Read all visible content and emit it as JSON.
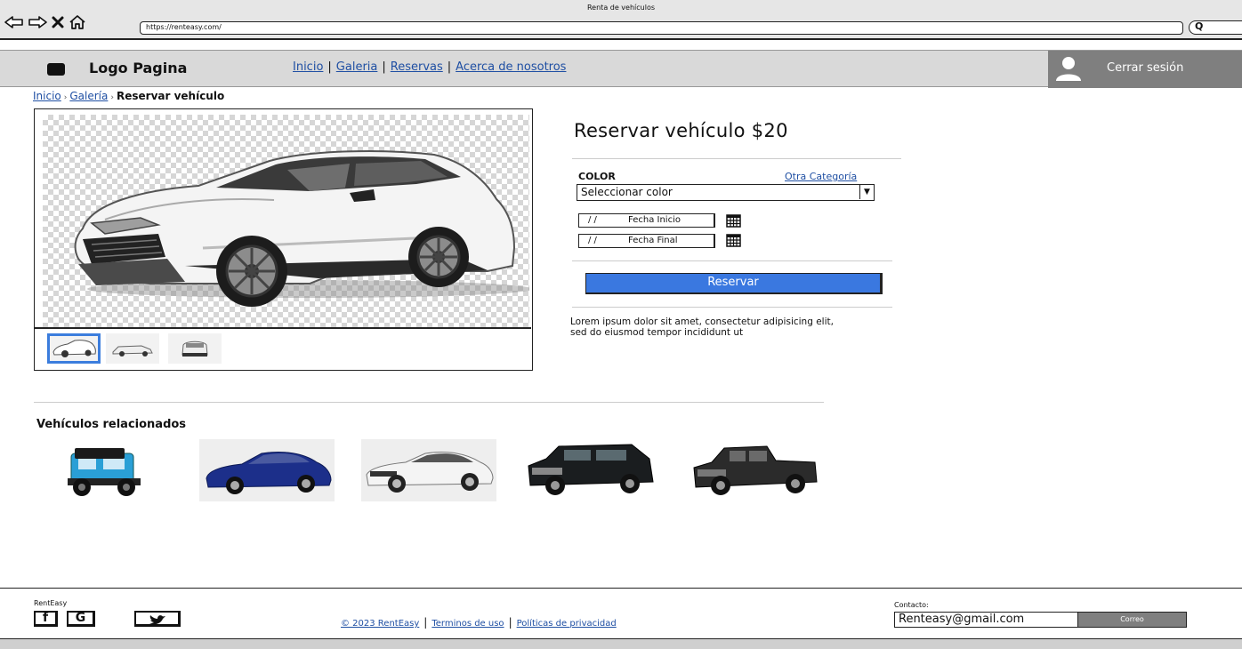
{
  "browser": {
    "window_title": "Renta de vehículos",
    "url": "https://renteasy.com/",
    "search_glyph": "Q"
  },
  "header": {
    "logo_text": "Logo Pagina",
    "nav": [
      "Inicio",
      "Galeria",
      "Reservas",
      "Acerca de nosotros"
    ],
    "logout_label": "Cerrar sesión"
  },
  "breadcrumb": {
    "items": [
      "Inicio",
      "Galería"
    ],
    "current": "Reservar vehículo"
  },
  "gallery": {
    "selected_thumbnail": 1,
    "thumbnail_count": 3
  },
  "booking": {
    "title": "Reservar vehículo $20",
    "color_label": "COLOR",
    "other_category_link": "Otra Categoría",
    "color_select_value": "Seleccionar color",
    "date_start_slashes": "/ /",
    "date_start_label": "Fecha Inicio",
    "date_end_slashes": "/ /",
    "date_end_label": "Fecha Final",
    "reserve_button": "Reservar",
    "description": "Lorem ipsum dolor sit amet, consectetur adipisicing elit, sed do eiusmod tempor incididunt ut"
  },
  "related": {
    "title": "Vehículos relacionados",
    "vehicles": [
      {
        "color": "#2a9fd6"
      },
      {
        "color": "#1c2f8a"
      },
      {
        "color": "#e8e8e8"
      },
      {
        "color": "#1a1d1f"
      },
      {
        "color": "#2b2b2b"
      }
    ]
  },
  "footer": {
    "brand": "RentEasy",
    "social": [
      "f",
      "G",
      "twitter"
    ],
    "copyright": "© 2023 RentEasy",
    "terms": "Terminos de uso",
    "privacy": "Políticas de privacidad",
    "contact_label": "Contacto:",
    "email_value": "Renteasy@gmail.com",
    "email_button": "Correo"
  },
  "colors": {
    "accent": "#3a78e0",
    "link": "#1f4fa3",
    "header_bg": "#d9d9d9",
    "user_bg": "#7f7f7f"
  }
}
